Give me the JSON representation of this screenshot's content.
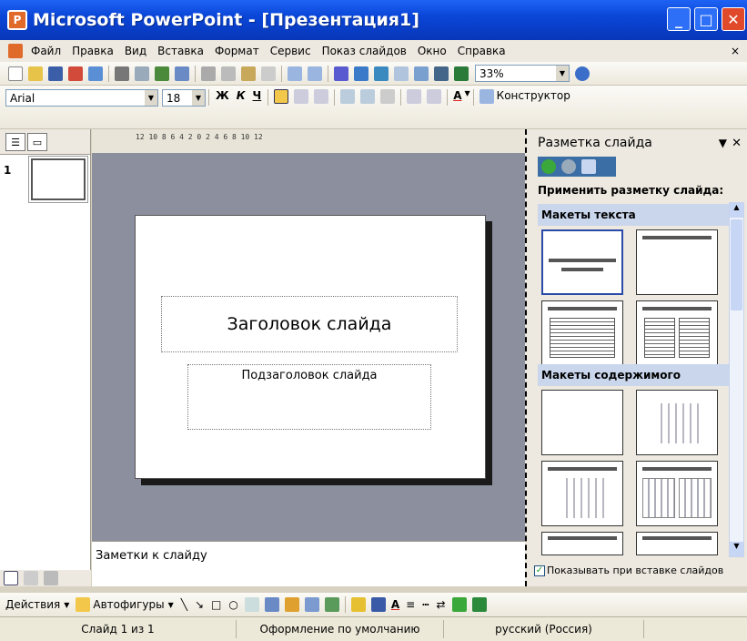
{
  "title": "Microsoft PowerPoint - [Презентация1]",
  "menu": [
    "Файл",
    "Правка",
    "Вид",
    "Вставка",
    "Формат",
    "Сервис",
    "Показ слайдов",
    "Окно",
    "Справка"
  ],
  "zoom": "33%",
  "font_name": "Arial",
  "font_size": "18",
  "designer_label": "Конструктор",
  "slide_number": "1",
  "ruler": "12 10 8 6 4 2 0 2 4 6 8 10 12",
  "slide": {
    "title_placeholder": "Заголовок слайда",
    "subtitle_placeholder": "Подзаголовок слайда"
  },
  "notes_placeholder": "Заметки к слайду",
  "taskpane": {
    "title": "Разметка слайда",
    "apply_label": "Применить разметку слайда:",
    "section_text": "Макеты текста",
    "section_content": "Макеты содержимого",
    "show_on_insert": "Показывать при вставке слайдов"
  },
  "drawing": {
    "actions": "Действия",
    "autoshapes": "Автофигуры"
  },
  "status": {
    "slide": "Слайд 1 из 1",
    "design": "Оформление по умолчанию",
    "language": "русский (Россия)"
  },
  "colors": {
    "titlebar": "#0a46d8",
    "close": "#e0492a",
    "section": "#c9d6ec"
  }
}
